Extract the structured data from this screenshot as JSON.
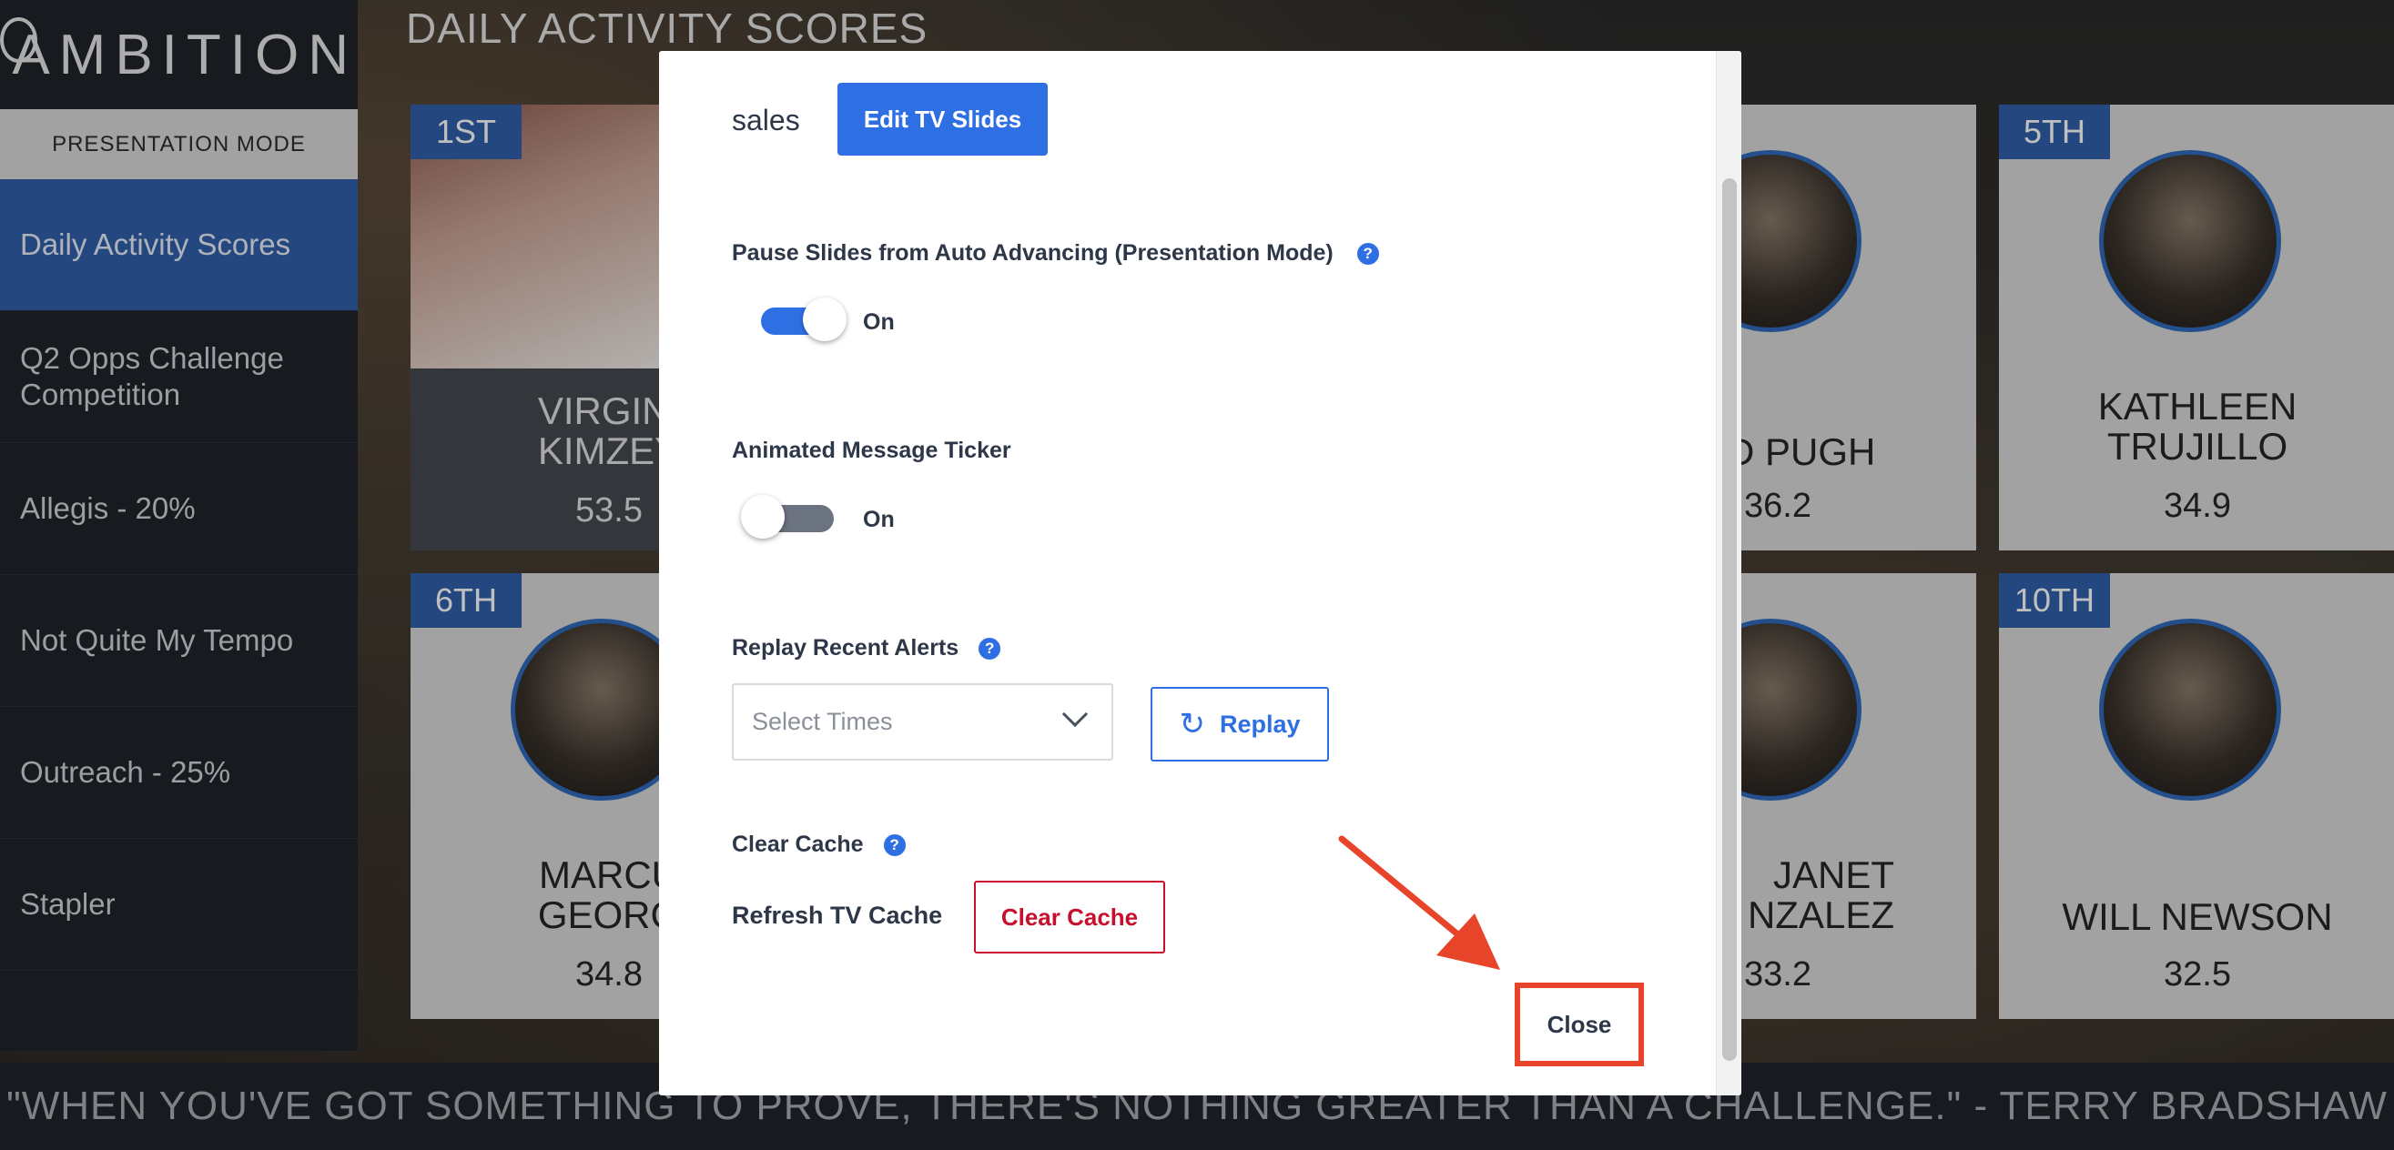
{
  "app": {
    "logo_text": "AMBITION",
    "presentation_mode": "PRESENTATION MODE",
    "page_title": "DAILY ACTIVITY SCORES"
  },
  "sidebar": {
    "items": [
      {
        "label": "Daily Activity Scores",
        "active": true
      },
      {
        "label": "Q2 Opps Challenge Competition",
        "active": false
      },
      {
        "label": "Allegis - 20%",
        "active": false
      },
      {
        "label": "Not Quite My Tempo",
        "active": false
      },
      {
        "label": "Outreach - 25%",
        "active": false
      },
      {
        "label": "Stapler",
        "active": false
      }
    ]
  },
  "leaderboard": {
    "cards": [
      {
        "rank": "1ST",
        "name": "VIRGINI\nKIMZEY",
        "score": "53.5"
      },
      {
        "rank": "",
        "name": "ALD PUGH",
        "score": "36.2"
      },
      {
        "rank": "5TH",
        "name": "KATHLEEN\nTRUJILLO",
        "score": "34.9"
      },
      {
        "rank": "6TH",
        "name": "MARCU\nGEORG",
        "score": "34.8"
      },
      {
        "rank": "",
        "name": "JANET\nNZALEZ",
        "score": "33.2"
      },
      {
        "rank": "10TH",
        "name": "WILL NEWSON",
        "score": "32.5"
      }
    ]
  },
  "ticker": {
    "text": "\"WHEN YOU'VE GOT SOMETHING TO PROVE, THERE'S NOTHING GREATER THAN A CHALLENGE.\" - TERRY BRADSHAW"
  },
  "modal": {
    "team_name": "sales",
    "edit_button": "Edit TV Slides",
    "pause_label": "Pause Slides from Auto Advancing (Presentation Mode)",
    "pause_toggle": {
      "state": "on",
      "text": "On"
    },
    "ticker_label": "Animated Message Ticker",
    "ticker_toggle": {
      "state": "off",
      "text": "On"
    },
    "replay_label": "Replay Recent Alerts",
    "select_placeholder": "Select Times",
    "replay_button": "Replay",
    "clear_cache_label": "Clear Cache",
    "refresh_label": "Refresh TV Cache",
    "clear_cache_button": "Clear Cache",
    "close_button": "Close",
    "help_glyph": "?"
  },
  "colors": {
    "primary": "#2f6fe4",
    "danger": "#c8102e",
    "annotation": "#e8442a",
    "sidebar_active": "#2f5fa8"
  },
  "icons": {
    "help": "question-circle-icon",
    "chevron": "chevron-down-icon",
    "replay": "refresh-icon",
    "annotation": "red-arrow-icon"
  }
}
